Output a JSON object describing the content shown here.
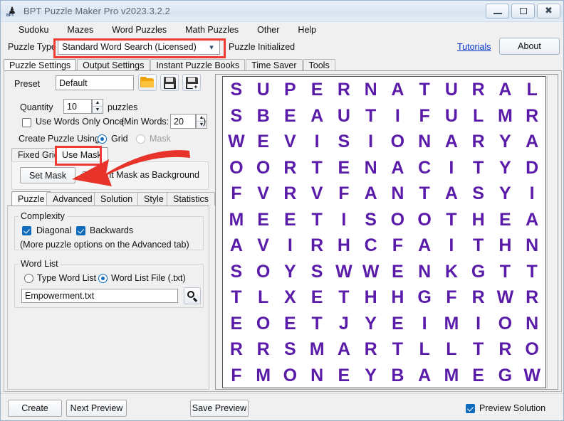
{
  "window": {
    "title": "BPT Puzzle Maker Pro v2023.3.2.2",
    "icon": "app-icon",
    "minimize_label": "–",
    "maximize_label": "□",
    "close_label": "✕"
  },
  "menu": {
    "items": [
      "Sudoku",
      "Mazes",
      "Word Puzzles",
      "Math Puzzles",
      "Other",
      "Help"
    ]
  },
  "puzzle_type": {
    "label": "Puzzle Type",
    "value": "Standard Word Search (Licensed)",
    "chevron": "⌄",
    "status": "Puzzle Initialized",
    "tutorials_link": "Tutorials",
    "about_button": "About"
  },
  "main_tabs": {
    "items": [
      "Puzzle Settings",
      "Output Settings",
      "Instant Puzzle Books",
      "Time Saver",
      "Tools"
    ],
    "active": "Puzzle Settings"
  },
  "preset": {
    "label": "Preset",
    "value": "Default",
    "open_icon": "folder-open-icon",
    "save_icon": "save-icon",
    "save_as_icon": "save-as-icon"
  },
  "quantity": {
    "label": "Quantity",
    "value": "10",
    "unit": "puzzles",
    "spin_up": "▲",
    "spin_down": "▼"
  },
  "use_words_once": {
    "label": "Use Words Only Once",
    "checked": false,
    "min_words_prefix": "(Min Words:",
    "min_words_value": "20",
    "min_words_suffix": ")"
  },
  "create_using": {
    "label": "Create Puzzle Using:",
    "grid_label": "Grid",
    "mask_label": "Mask",
    "selected": "Grid"
  },
  "grid_tabs": {
    "items": [
      "Fixed Grid",
      "Use Mask"
    ],
    "active": "Use Mask"
  },
  "mask_panel": {
    "set_mask_button": "Set Mask",
    "print_mask_label": "Print Mask as Background",
    "print_mask_checked": false
  },
  "sub_tabs": {
    "items": [
      "Puzzle",
      "Advanced",
      "Solution",
      "Style",
      "Statistics"
    ],
    "active": "Puzzle"
  },
  "complexity": {
    "group_title": "Complexity",
    "diagonal_label": "Diagonal",
    "diagonal_checked": true,
    "backwards_label": "Backwards",
    "backwards_checked": true,
    "note": "(More puzzle options on the Advanced tab)"
  },
  "word_list": {
    "group_title": "Word List",
    "type_option": "Type Word List",
    "file_option": "Word List File (.txt)",
    "selected": "Word List File (.txt)",
    "file_value": "Empowerment.txt",
    "browse_icon": "magnifier-icon"
  },
  "bottom_bar": {
    "create_button": "Create",
    "next_preview_button": "Next Preview",
    "save_preview_button": "Save Preview",
    "preview_solution_label": "Preview Solution",
    "preview_solution_checked": true
  },
  "colors": {
    "letter_purple": "#5a1ba9",
    "annotation_red": "#ef3b34",
    "link_blue": "#0033cc",
    "accent_blue": "#0f6cbd"
  },
  "puzzle_grid": {
    "rows": 12,
    "cols": 12,
    "letters": [
      [
        "S",
        "U",
        "P",
        "E",
        "R",
        "N",
        "A",
        "T",
        "U",
        "R",
        "A",
        "L"
      ],
      [
        "S",
        "B",
        "E",
        "A",
        "U",
        "T",
        "I",
        "F",
        "U",
        "L",
        "M",
        "R"
      ],
      [
        "W",
        "E",
        "V",
        "I",
        "S",
        "I",
        "O",
        "N",
        "A",
        "R",
        "Y",
        "A"
      ],
      [
        "O",
        "O",
        "R",
        "T",
        "E",
        "N",
        "A",
        "C",
        "I",
        "T",
        "Y",
        "D"
      ],
      [
        "F",
        "V",
        "R",
        "V",
        "F",
        "A",
        "N",
        "T",
        "A",
        "S",
        "Y",
        "I"
      ],
      [
        "M",
        "E",
        "E",
        "T",
        "I",
        "S",
        "O",
        "O",
        "T",
        "H",
        "E",
        "A"
      ],
      [
        "A",
        "V",
        "I",
        "R",
        "H",
        "C",
        "F",
        "A",
        "I",
        "T",
        "H",
        "N"
      ],
      [
        "S",
        "O",
        "Y",
        "S",
        "W",
        "W",
        "E",
        "N",
        "K",
        "G",
        "T",
        "T"
      ],
      [
        "T",
        "L",
        "X",
        "E",
        "T",
        "H",
        "H",
        "G",
        "F",
        "R",
        "W",
        "R"
      ],
      [
        "E",
        "O",
        "E",
        "T",
        "J",
        "Y",
        "E",
        "I",
        "M",
        "I",
        "O",
        "N"
      ],
      [
        "R",
        "R",
        "S",
        "M",
        "A",
        "R",
        "T",
        "L",
        "L",
        "T",
        "R",
        "O"
      ],
      [
        "F",
        "M",
        "O",
        "N",
        "E",
        "Y",
        "B",
        "A",
        "M",
        "E",
        "G",
        "W"
      ]
    ]
  }
}
